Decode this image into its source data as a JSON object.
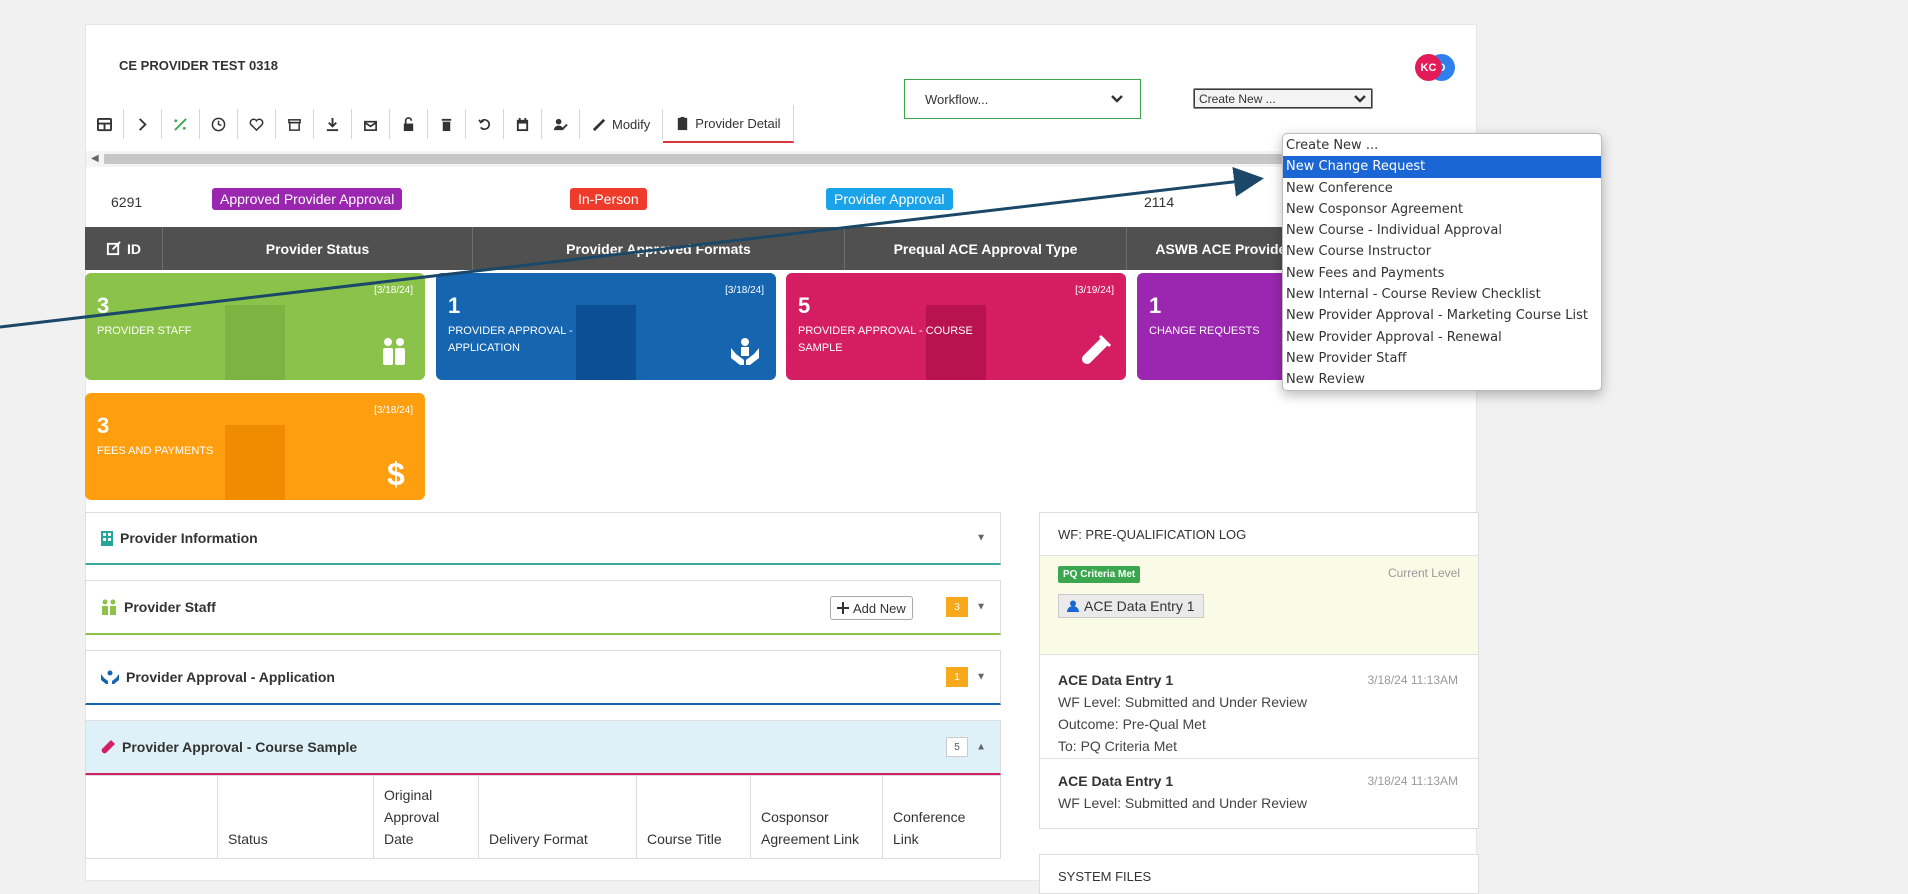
{
  "header": {
    "title": "CE PROVIDER TEST 0318",
    "avatar_initials_1": "D",
    "avatar_initials_2": "KC"
  },
  "toolbar": {
    "modify_label": "Modify",
    "provider_detail_label": "Provider Detail",
    "workflow_value": "Workflow...",
    "create_new_value": "Create New ..."
  },
  "info_row": {
    "id": "6291",
    "provider_status": "Approved Provider Approval",
    "formats": "In-Person",
    "approval_type": "Provider Approval",
    "aswb_id": "2114",
    "colors": {
      "status": "#9b27b0",
      "formats": "#ee3b2b",
      "type": "#1aa3e8"
    }
  },
  "table_header": {
    "id": "ID",
    "provider_status": "Provider Status",
    "formats": "Provider Approved Formats",
    "approval_type": "Prequal ACE Approval Type",
    "aswb": "ASWB ACE Provider ID"
  },
  "tiles": [
    {
      "count": "3",
      "label": "PROVIDER STAFF",
      "date": "[3/18/24]",
      "color": "#8bc34a",
      "icon": "people-icon"
    },
    {
      "count": "1",
      "label": "PROVIDER APPROVAL - APPLICATION",
      "date": "[3/18/24]",
      "color": "#1565b0",
      "icon": "hands-icon"
    },
    {
      "count": "5",
      "label": "PROVIDER APPROVAL - COURSE SAMPLE",
      "date": "[3/19/24]",
      "color": "#d51d63",
      "icon": "flask-icon"
    },
    {
      "count": "1",
      "label": "CHANGE REQUESTS",
      "date": "",
      "color": "#9b27b0",
      "icon": ""
    },
    {
      "count": "3",
      "label": "FEES AND PAYMENTS",
      "date": "[3/18/24]",
      "color": "#ff9f0f",
      "icon": "dollar-icon"
    }
  ],
  "panels": {
    "provider_information": "Provider Information",
    "provider_staff": "Provider Staff",
    "provider_staff_count": "3",
    "add_new_label": "Add New",
    "approval_application": "Provider Approval - Application",
    "approval_application_count": "1",
    "course_sample": "Provider Approval - Course Sample",
    "course_sample_count": "5"
  },
  "course_table": {
    "columns": [
      "",
      "Status",
      "Original Approval Date",
      "Delivery Format",
      "Course Title",
      "Cosponsor Agreement Link",
      "Conference Link"
    ]
  },
  "workflow_log": {
    "title": "WF: PRE-QUALIFICATION LOG",
    "current_badge": "PQ Criteria Met",
    "current_level": "Current Level",
    "assignee": "ACE Data Entry 1",
    "entries": [
      {
        "who": "ACE Data Entry 1",
        "time": "3/18/24 11:13AM",
        "level": "WF Level: Submitted and Under Review",
        "outcome": "Outcome: Pre-Qual Met",
        "to": "To: PQ Criteria Met"
      },
      {
        "who": "ACE Data Entry 1",
        "time": "3/18/24 11:13AM",
        "level": "WF Level: Submitted and Under Review"
      }
    ]
  },
  "system_files": {
    "title": "SYSTEM FILES"
  },
  "create_new_menu": {
    "selected_index": 1,
    "options": [
      "Create New ...",
      "New Change Request",
      "New Conference",
      "New Cosponsor Agreement",
      "New Course - Individual Approval",
      "New Course Instructor",
      "New Fees and Payments",
      "New Internal - Course Review Checklist",
      "New Provider Approval - Marketing Course List",
      "New Provider Approval - Renewal",
      "New Provider Staff",
      "New Review"
    ]
  }
}
